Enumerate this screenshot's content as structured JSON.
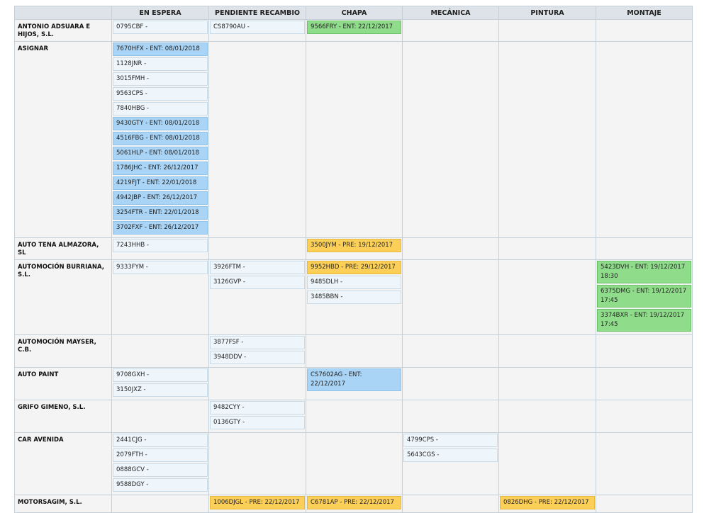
{
  "columns": [
    "",
    "EN ESPERA",
    "PENDIENTE RECAMBIO",
    "CHAPA",
    "MECÁNICA",
    "PINTURA",
    "MONTAJE"
  ],
  "colors": {
    "blue": "#a9d4f5",
    "green": "#8fdc8a",
    "yellow": "#fcd058",
    "default": "#eef6fb"
  },
  "rows": [
    {
      "client": "ANTONIO ADSUARA E HIJOS, S.L.",
      "cells": [
        [
          {
            "text": "0795CBF -",
            "color": "default"
          }
        ],
        [
          {
            "text": "CS8790AU -",
            "color": "default"
          }
        ],
        [
          {
            "text": "9566FRY - ENT: 22/12/2017",
            "color": "green"
          }
        ],
        [],
        [],
        []
      ]
    },
    {
      "client": "ASIGNAR",
      "cells": [
        [
          {
            "text": "7670HFX - ENT: 08/01/2018",
            "color": "blue"
          },
          {
            "text": "1128JNR -",
            "color": "default"
          },
          {
            "text": "3015FMH -",
            "color": "default"
          },
          {
            "text": "9563CPS -",
            "color": "default"
          },
          {
            "text": "7840HBG -",
            "color": "default"
          },
          {
            "text": "9430GTY - ENT: 08/01/2018",
            "color": "blue"
          },
          {
            "text": "4516FBG - ENT: 08/01/2018",
            "color": "blue"
          },
          {
            "text": "5061HLP - ENT: 08/01/2018",
            "color": "blue"
          },
          {
            "text": "1786JHC - ENT: 26/12/2017",
            "color": "blue"
          },
          {
            "text": "4219FJT - ENT: 22/01/2018",
            "color": "blue"
          },
          {
            "text": "4942JBP - ENT: 26/12/2017",
            "color": "blue"
          },
          {
            "text": "3254FTR - ENT: 22/01/2018",
            "color": "blue"
          },
          {
            "text": "3702FXF - ENT: 26/12/2017",
            "color": "blue"
          }
        ],
        [],
        [],
        [],
        [],
        []
      ]
    },
    {
      "client": "AUTO TENA ALMAZORA, SL",
      "cells": [
        [
          {
            "text": "7243HHB -",
            "color": "default"
          }
        ],
        [],
        [
          {
            "text": "3500JYM - PRE: 19/12/2017",
            "color": "yellow"
          }
        ],
        [],
        [],
        []
      ]
    },
    {
      "client": "AUTOMOCIÓN BURRIANA, S.L.",
      "cells": [
        [
          {
            "text": "9333FYM -",
            "color": "default"
          }
        ],
        [
          {
            "text": "3926FTM -",
            "color": "default"
          },
          {
            "text": "3126GVP -",
            "color": "default"
          }
        ],
        [
          {
            "text": "9952HBD - PRE: 29/12/2017",
            "color": "yellow"
          },
          {
            "text": "9485DLH -",
            "color": "default"
          },
          {
            "text": "3485BBN -",
            "color": "default"
          }
        ],
        [],
        [],
        [
          {
            "text": "5423DVH - ENT: 19/12/2017\n18:30",
            "color": "green"
          },
          {
            "text": "6375DMG - ENT: 19/12/2017\n17:45",
            "color": "green"
          },
          {
            "text": "3374BXR - ENT: 19/12/2017\n17:45",
            "color": "green"
          }
        ]
      ]
    },
    {
      "client": "AUTOMOCIÓN MAYSER, C.B.",
      "cells": [
        [],
        [
          {
            "text": "3877FSF -",
            "color": "default"
          },
          {
            "text": "3948DDV -",
            "color": "default"
          }
        ],
        [],
        [],
        [],
        []
      ]
    },
    {
      "client": "AUTO PAINT",
      "cells": [
        [
          {
            "text": "9708GXH -",
            "color": "default"
          },
          {
            "text": "3150JXZ -",
            "color": "default"
          }
        ],
        [],
        [
          {
            "text": "CS7602AG - ENT: 22/12/2017",
            "color": "blue"
          }
        ],
        [],
        [],
        []
      ]
    },
    {
      "client": "GRIFO GIMENO, S.L.",
      "cells": [
        [],
        [
          {
            "text": "9482CYY -",
            "color": "default"
          },
          {
            "text": "0136GTY -",
            "color": "default"
          }
        ],
        [],
        [],
        [],
        []
      ]
    },
    {
      "client": "CAR AVENIDA",
      "cells": [
        [
          {
            "text": "2441CJG -",
            "color": "default"
          },
          {
            "text": "2079FTH -",
            "color": "default"
          },
          {
            "text": "0888GCV -",
            "color": "default"
          },
          {
            "text": "9588DGY -",
            "color": "default"
          }
        ],
        [],
        [],
        [
          {
            "text": "4799CPS -",
            "color": "default"
          },
          {
            "text": "5643CGS -",
            "color": "default"
          }
        ],
        [],
        []
      ]
    },
    {
      "client": "MOTORSAGIM, S.L.",
      "cells": [
        [],
        [
          {
            "text": "1006DJGL - PRE: 22/12/2017",
            "color": "yellow"
          }
        ],
        [
          {
            "text": "C6781AP - PRE: 22/12/2017",
            "color": "yellow"
          }
        ],
        [],
        [
          {
            "text": "0826DHG - PRE: 22/12/2017",
            "color": "yellow"
          }
        ],
        []
      ]
    }
  ]
}
